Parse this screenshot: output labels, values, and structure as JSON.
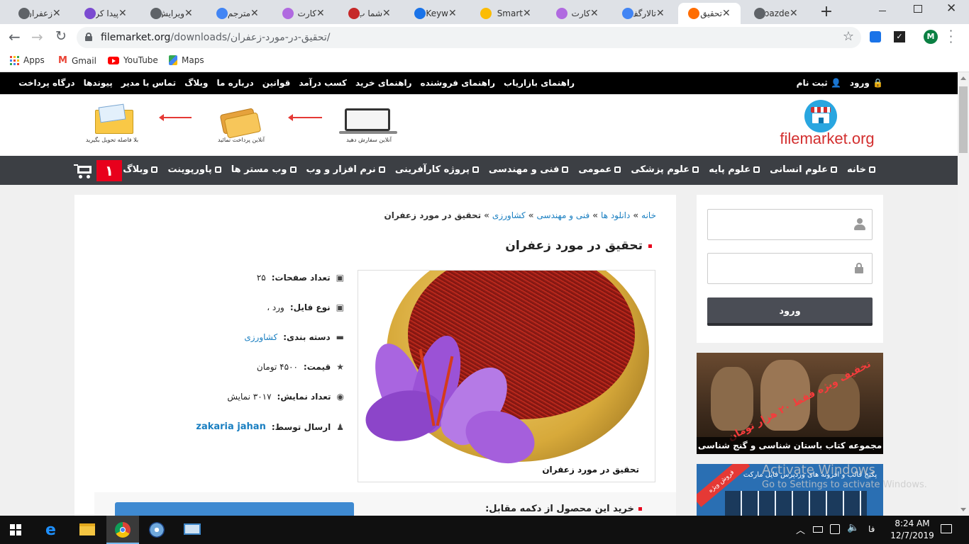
{
  "browser": {
    "tabs": [
      {
        "title": "زعفران",
        "icon": "globe-icon",
        "color": "#5f6368"
      },
      {
        "title": "پیدا کر",
        "icon": "purple-circle-icon",
        "color": "#7b4bd1"
      },
      {
        "title": "ویرایش",
        "icon": "globe-icon",
        "color": "#5f6368"
      },
      {
        "title": "مترجم",
        "icon": "translate-icon",
        "color": "#4285f4"
      },
      {
        "title": "کارت",
        "icon": "purple-circle-icon",
        "color": "#b06ae0"
      },
      {
        "title": "شما ب",
        "icon": "x-icon",
        "color": "#c62828"
      },
      {
        "title": "Keyw",
        "icon": "keyword-icon",
        "color": "#1a73e8"
      },
      {
        "title": "Smart",
        "icon": "ads-icon",
        "color": "#fbbc04"
      },
      {
        "title": "کارت",
        "icon": "purple-circle-icon",
        "color": "#b06ae0"
      },
      {
        "title": "تالارگف",
        "icon": "google-icon",
        "color": "#4285f4"
      },
      {
        "title": "تحقیق",
        "icon": "f-icon",
        "color": "#ff6d00",
        "active": true
      },
      {
        "title": "bazde",
        "icon": "globe-icon",
        "color": "#5f6368"
      }
    ],
    "new_tab": "+",
    "url_host": "filemarket.org",
    "url_path": "/downloads/تحقیق-در-مورد-زعفران/",
    "bookmarks": [
      {
        "label": "Apps"
      },
      {
        "label": "Gmail"
      },
      {
        "label": "YouTube"
      },
      {
        "label": "Maps"
      }
    ],
    "profile_initial": "M"
  },
  "site": {
    "top_links": [
      "راهنمای بازاریاب",
      "راهنمای فروشنده",
      "راهنمای خرید",
      "کسب درآمد",
      "قوانین",
      "درباره ما",
      "وبلاگ",
      "تماس با مدیر",
      "پیوندها",
      "درگاه پرداخت"
    ],
    "auth": {
      "login": "ورود",
      "register": "ثبت نام"
    },
    "logo_text": "filemarket.org",
    "steps": [
      {
        "caption": "آنلاین سفارش دهید"
      },
      {
        "caption": "آنلاین پرداخت نمائید"
      },
      {
        "caption": "بلا فاصله تحویل بگیرید"
      }
    ],
    "main_nav": [
      "خانه",
      "علوم انسانی",
      "علوم پایه",
      "علوم پزشکی",
      "عمومی",
      "فنی و مهندسی",
      "پروژه کارآفرینی",
      "نرم افزار و وب",
      "وب مستر ها",
      "پاورپوینت",
      "وبلاگ"
    ],
    "cart_count": "۱"
  },
  "product": {
    "breadcrumb": [
      "خانه",
      "دانلود ها",
      "فنی و مهندسی",
      "کشاورزی",
      "تحقیق در مورد زعفران"
    ],
    "title": "تحقیق در مورد زعفران",
    "image_caption": "تحقیق در مورد زعفران",
    "specs": [
      {
        "label": "تعداد صفحات:",
        "value": "۲۵",
        "icon": "cube-icon"
      },
      {
        "label": "نوع فایل:",
        "value": "ورد ،",
        "icon": "cube-icon"
      },
      {
        "label": "دسته بندی:",
        "value": "کشاورزی",
        "icon": "folder-icon",
        "link": true
      },
      {
        "label": "قیمت:",
        "value": "۴۵۰۰ تومان",
        "icon": "star-icon"
      },
      {
        "label": "تعداد نمایش:",
        "value": "۳۰۱۷ نمایش",
        "icon": "eye-icon"
      },
      {
        "label": "ارسال توسط:",
        "value": "zakaria jahan",
        "icon": "user-icon",
        "link": true
      }
    ],
    "buy_heading": "خرید این محصول از دکمه مقابل:"
  },
  "sidebar": {
    "login_button": "ورود",
    "banner1_caption": "مجموعه کتاب باستان شناسی و گنج شناسی",
    "banner1_overlay": "تخفیف ویژه فقط ۲۰ هزار تومان",
    "banner2_text": "پکیج قالب و افزونه های وردپرس فایل مارکت",
    "banner2_badge": "فروش ویژه"
  },
  "os": {
    "watermark_title": "Activate Windows",
    "watermark_sub": "Go to Settings to activate Windows.",
    "time": "8:24 AM",
    "date": "12/7/2019",
    "lang": "فا"
  }
}
